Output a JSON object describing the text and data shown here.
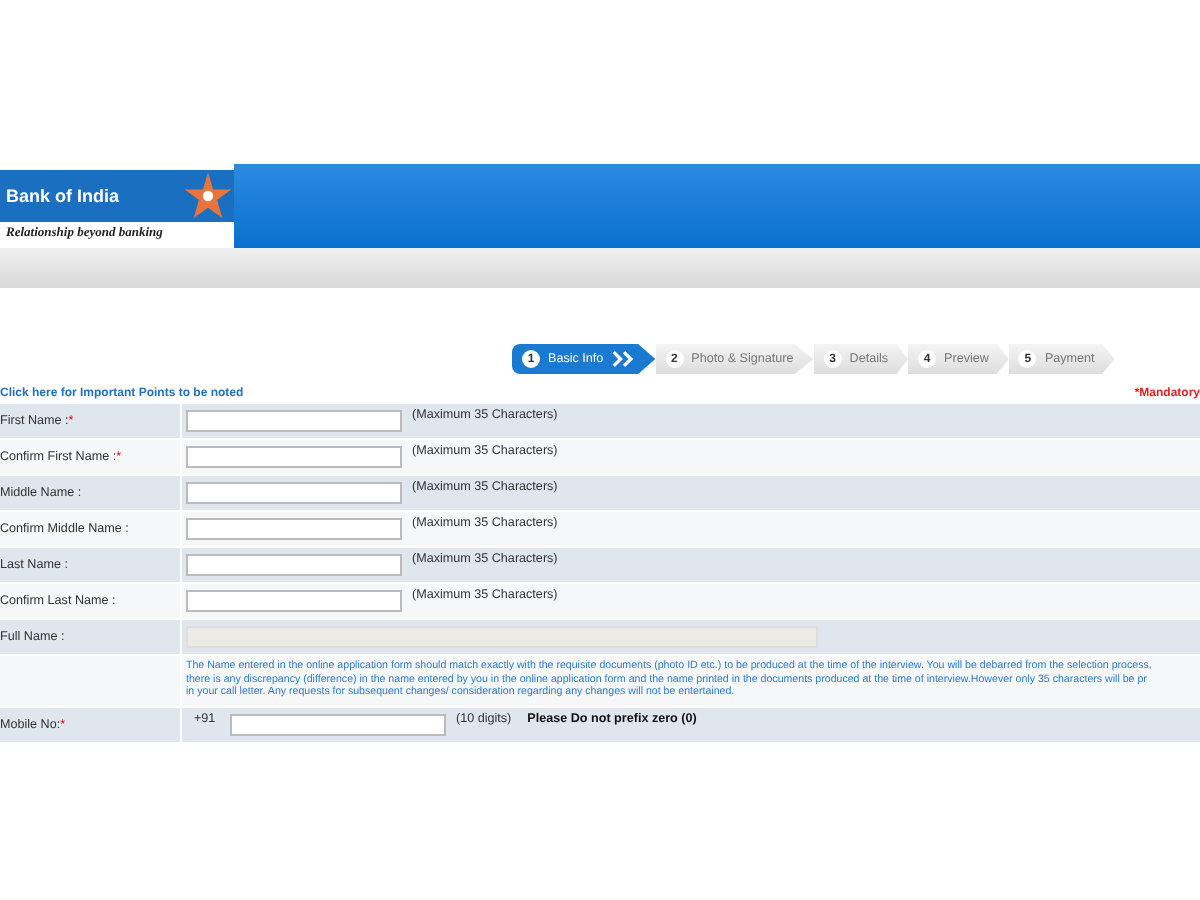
{
  "logo": {
    "name": "Bank of India",
    "tagline": "Relationship beyond banking"
  },
  "steps": [
    {
      "number": "1",
      "label": "Basic Info",
      "selected": true
    },
    {
      "number": "2",
      "label": "Photo & Signature",
      "selected": false
    },
    {
      "number": "3",
      "label": "Details",
      "selected": false
    },
    {
      "number": "4",
      "label": "Preview",
      "selected": false
    },
    {
      "number": "5",
      "label": "Payment",
      "selected": false
    }
  ],
  "notice_link": "Click here for Important Points to be noted",
  "mandatory_note": "*Mandatory",
  "required_marker": "*",
  "fields": [
    {
      "label": "First Name :",
      "required": true,
      "hint": "(Maximum 35 Characters)",
      "kind": "text"
    },
    {
      "label": "Confirm First Name :",
      "required": true,
      "hint": "(Maximum 35 Characters)",
      "kind": "text"
    },
    {
      "label": "Middle Name :",
      "required": false,
      "hint": "(Maximum 35 Characters)",
      "kind": "text"
    },
    {
      "label": "Confirm Middle Name :",
      "required": false,
      "hint": "(Maximum 35 Characters)",
      "kind": "text"
    },
    {
      "label": "Last Name :",
      "required": false,
      "hint": "(Maximum 35 Characters)",
      "kind": "text"
    },
    {
      "label": "Confirm Last Name :",
      "required": false,
      "hint": "(Maximum 35 Characters)",
      "kind": "text"
    },
    {
      "label": "Full Name :",
      "required": false,
      "kind": "readonly"
    },
    {
      "kind": "note",
      "lines": [
        "The Name entered in the online application form should match exactly with the requisite documents (photo ID etc.) to be produced at the time of the interview. You will be debarred from the selection process,",
        "there is any discrepancy (difference) in the name entered by you in the online application form and the name printed in the documents produced at the time of interview.However only 35 characters will be pr",
        "in your call letter. Any requests for subsequent changes/ consideration regarding any changes will not be entertained."
      ]
    },
    {
      "label": "Mobile No:",
      "required": true,
      "kind": "phone",
      "prefix": "+91",
      "hint": "(10 digits)",
      "warning": "Please Do not prefix zero (0)"
    }
  ]
}
